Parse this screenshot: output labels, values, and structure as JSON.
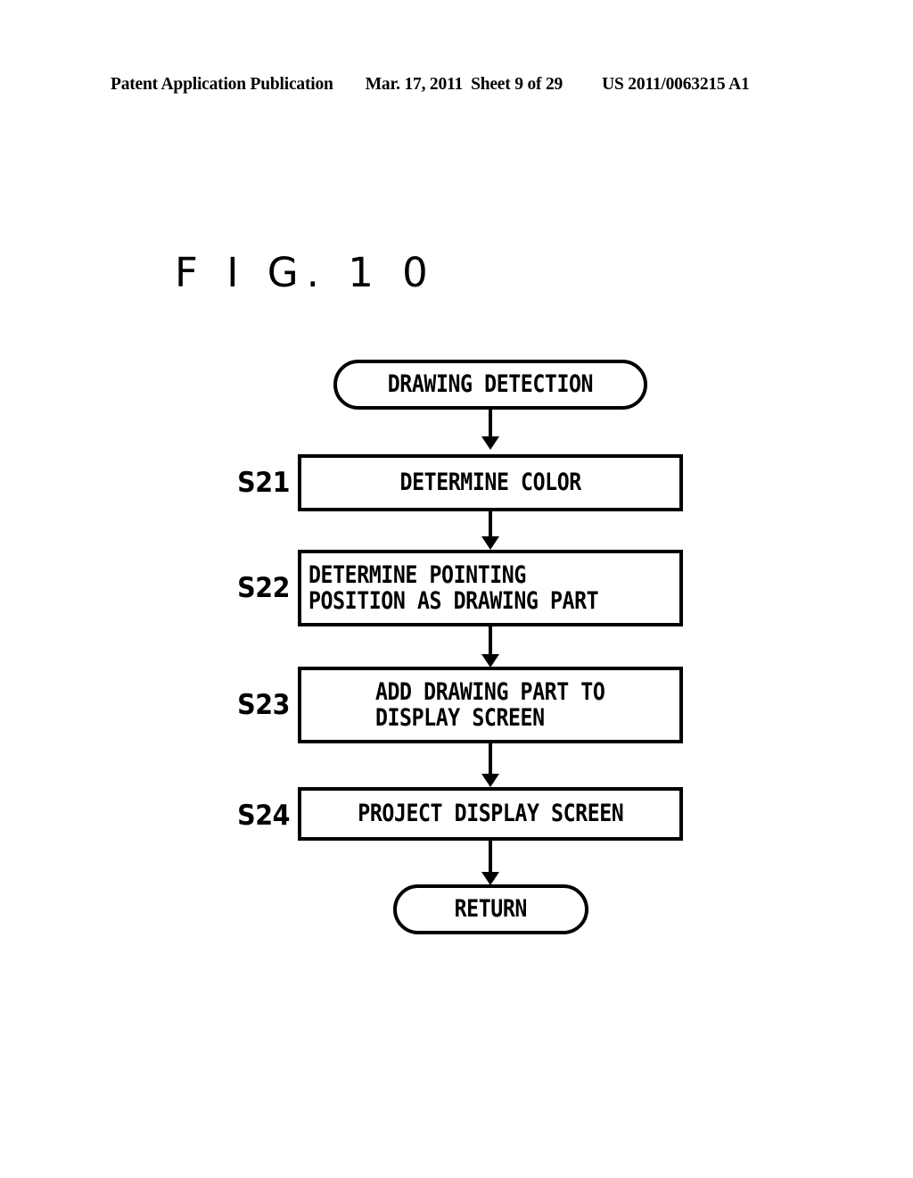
{
  "header": {
    "publication": "Patent Application Publication",
    "date": "Mar. 17, 2011",
    "sheet": "Sheet 9 of 29",
    "patent_number": "US 2011/0063215 A1"
  },
  "figure": {
    "title": "F I G.  1 0"
  },
  "flowchart": {
    "start": {
      "label": "DRAWING DETECTION",
      "shape": "terminator"
    },
    "steps": [
      {
        "id": "S21",
        "label": "DETERMINE COLOR",
        "shape": "process",
        "align": "center"
      },
      {
        "id": "S22",
        "label": "DETERMINE POINTING\nPOSITION AS DRAWING PART",
        "shape": "process",
        "align": "left"
      },
      {
        "id": "S23",
        "label": "ADD DRAWING PART TO\nDISPLAY SCREEN",
        "shape": "process",
        "align": "left"
      },
      {
        "id": "S24",
        "label": "PROJECT DISPLAY SCREEN",
        "shape": "process",
        "align": "center"
      }
    ],
    "end": {
      "label": "RETURN",
      "shape": "terminator"
    },
    "colors": {
      "ink": "#000000",
      "paper": "#ffffff"
    }
  }
}
